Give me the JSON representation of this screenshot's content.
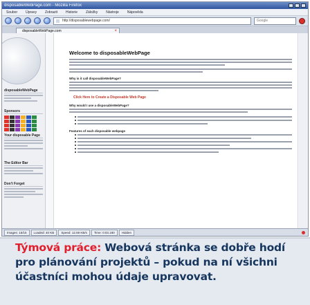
{
  "browser": {
    "window_title": "disposableWebPage.com - Mozilla Firefox",
    "menu": [
      "Soubor",
      "Úpravy",
      "Zobrazit",
      "Historie",
      "Záložky",
      "Nástroje",
      "Nápověda"
    ],
    "url": "http://disposablewebpage.com/",
    "search_placeholder": "Google",
    "tab_label": "disposableWebPage.com",
    "status": [
      "Images: 15/15",
      "Loaded: 40 KB",
      "Speed: 12.59 KB/s",
      "Time: 0:03.180",
      "Hidden"
    ]
  },
  "page": {
    "heading": "Welcome to disposableWebPage",
    "sidebar_heads": [
      "disposableWebPage",
      "Sponsors",
      "Your disposable Page",
      "The Editor Bar",
      "Don't Forget"
    ],
    "cta": "Click Here to Create a Disposable Web Page",
    "subheads": [
      "Why is it call disposableWebPage?",
      "Why would I use a disposableWebPage?",
      "Features of each disposable webpage"
    ]
  },
  "caption": {
    "lead": "Týmová práce:",
    "text": " Webová stránka se dobře hodí pro plánování projektů – pokud na ní všichni účastníci mohou údaje upravovat."
  },
  "colors": {
    "caption_lead": "#e21f2d",
    "caption_text": "#16365e",
    "caption_bg": "#e5eaf1",
    "sponsor_palette": [
      "#e0312b",
      "#2a8a3e",
      "#2a56c0",
      "#f0b020",
      "#8a3ab0",
      "#333333"
    ]
  }
}
